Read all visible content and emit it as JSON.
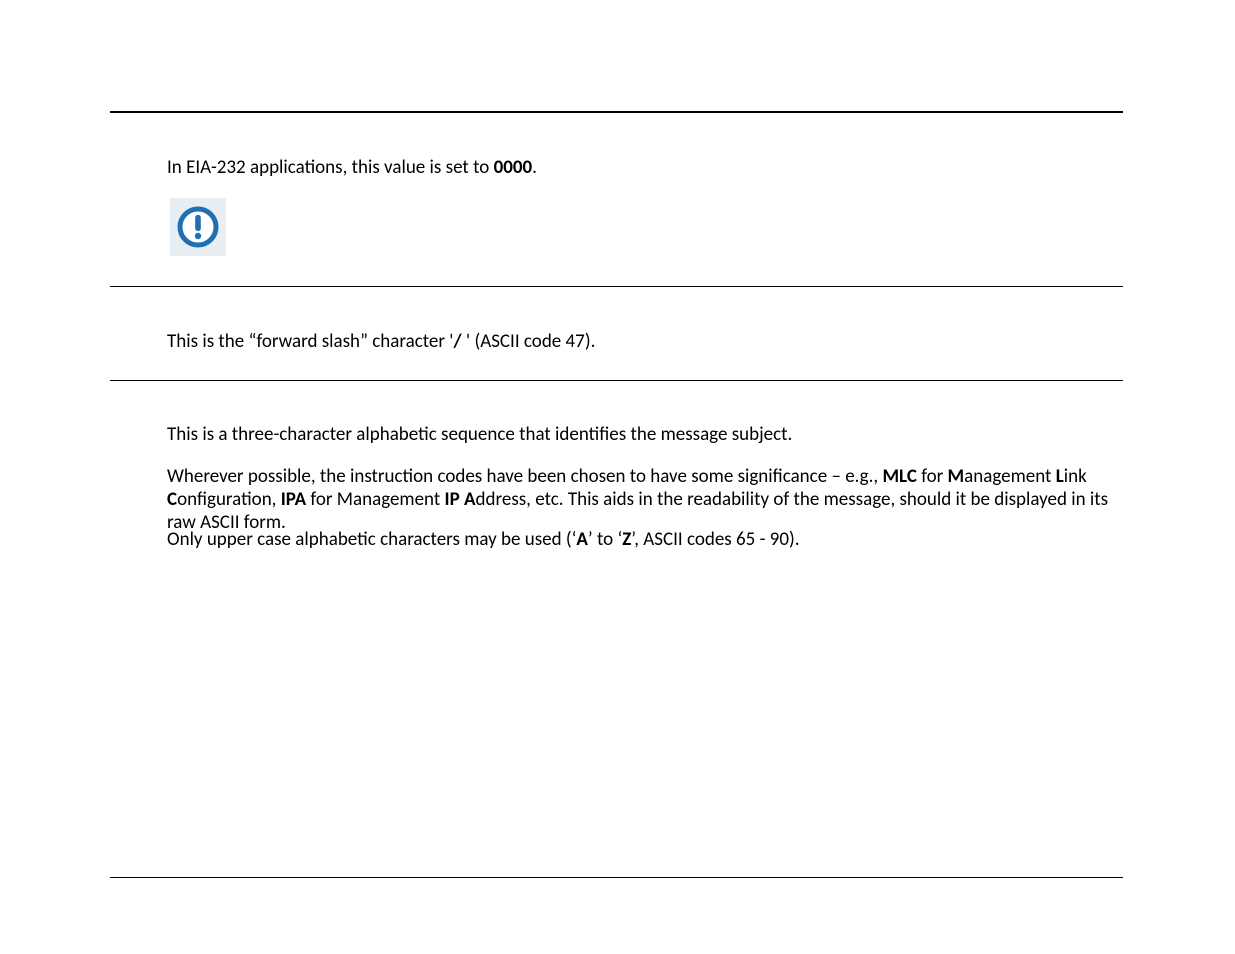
{
  "s1": {
    "pre": "In EIA-232 applications, this value is set to ",
    "bold": "0000",
    "post": "."
  },
  "s2": {
    "pre": "This is the “forward slash” character '",
    "bold": "/",
    "post": " ' (ASCII code 47)."
  },
  "s3": {
    "text": "This is a three-character alphabetic sequence that identifies the message subject."
  },
  "s4": {
    "t0": "Wherever possible, the instruction codes have been chosen to have some significance – e.g., ",
    "b1": "MLC",
    "t1": " for ",
    "b2": "M",
    "t2": "anagement ",
    "b3": "L",
    "t3": "ink ",
    "b4": "C",
    "t4": "onfiguration, ",
    "b5": "IPA",
    "t5": " for Management ",
    "b6": "IP A",
    "t6": "ddress, etc. This aids in the readability of the message, should it be displayed in its raw ASCII form."
  },
  "s5": {
    "t0": "Only upper case alphabetic characters may be used (‘",
    "b1": "A",
    "t1": "’ to ‘",
    "b2": "Z",
    "t2": "’, ASCII codes 65 - 90)."
  },
  "icon": {
    "name": "alert-circle-icon"
  }
}
